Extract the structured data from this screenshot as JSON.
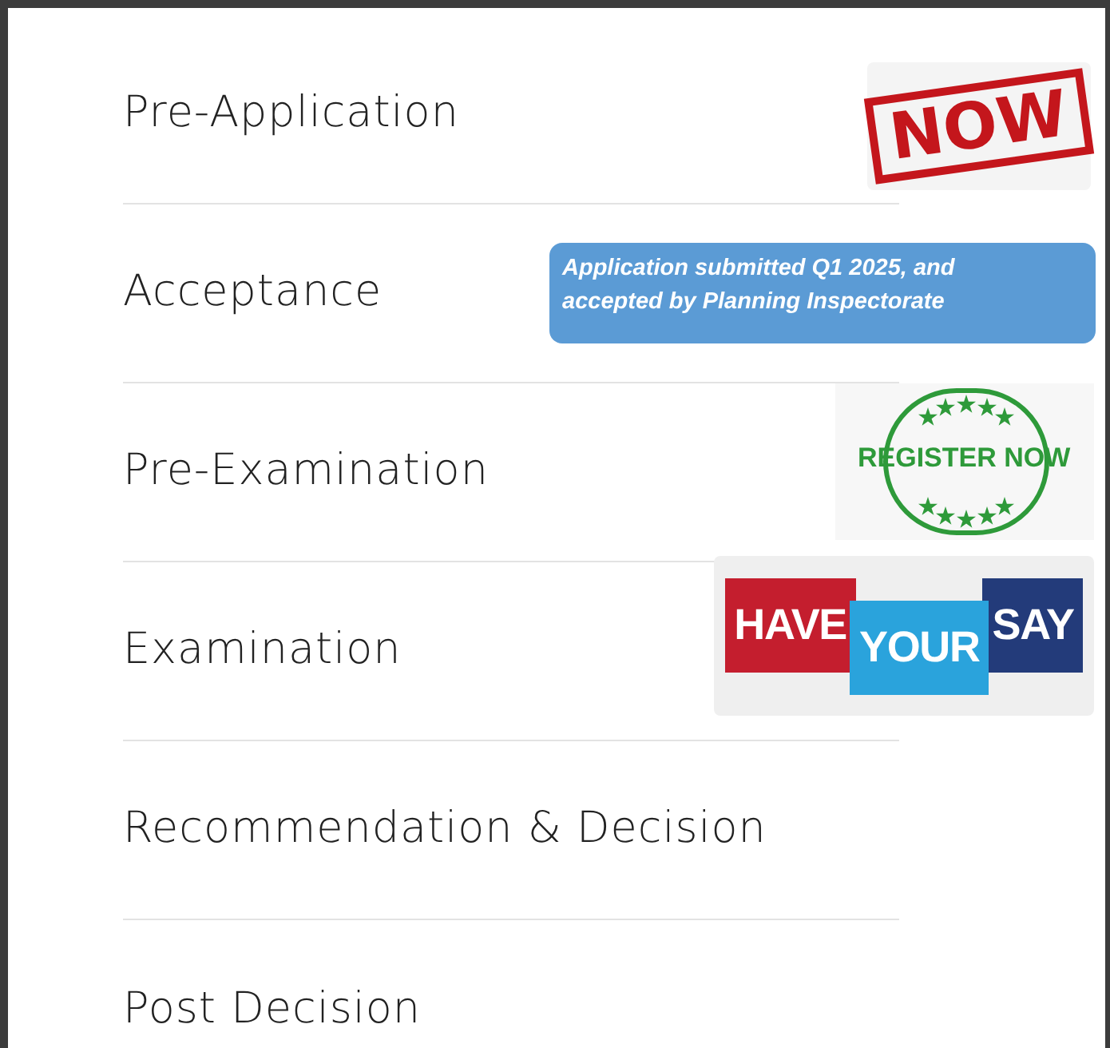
{
  "stages": [
    {
      "label": "Pre-Application",
      "badge": {
        "kind": "stamp",
        "text": "NOW"
      }
    },
    {
      "label": "Acceptance",
      "badge": {
        "kind": "note",
        "text": "Application submitted Q1 2025, and accepted by Planning Inspectorate"
      }
    },
    {
      "label": "Pre-Examination",
      "badge": {
        "kind": "seal",
        "text": "REGISTER NOW"
      }
    },
    {
      "label": "Examination",
      "badge": {
        "kind": "bubbles",
        "words": [
          "HAVE",
          "YOUR",
          "SAY"
        ]
      }
    },
    {
      "label": "Recommendation & Decision"
    },
    {
      "label": "Post Decision"
    }
  ]
}
